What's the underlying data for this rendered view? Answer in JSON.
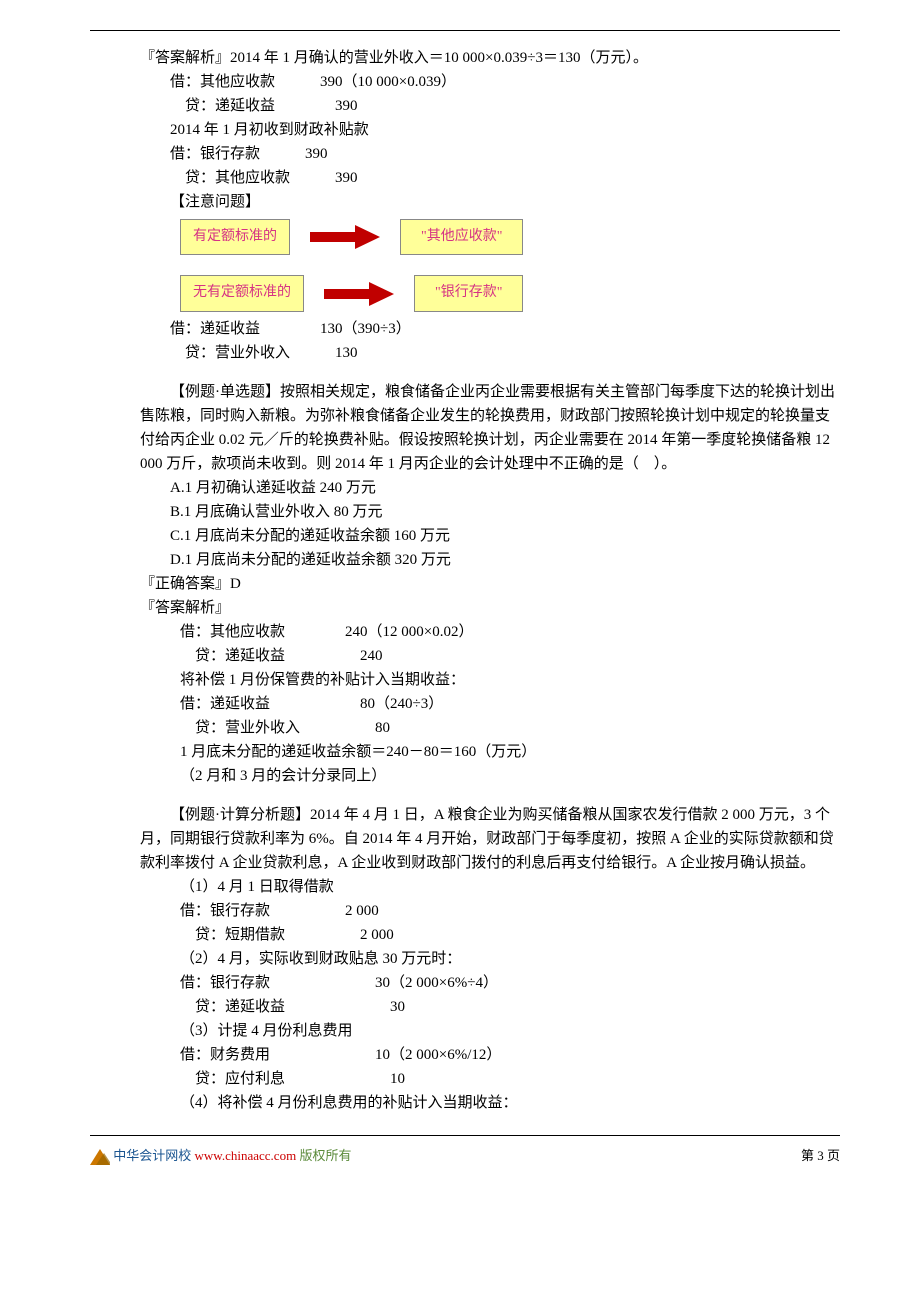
{
  "block1": {
    "l1": "『答案解析』2014 年 1 月确认的营业外收入＝10 000×0.039÷3＝130（万元）。",
    "l2": "借：其他应收款　　　390（10 000×0.039）",
    "l3": "　贷：递延收益　　　　390",
    "l4": "2014 年 1 月初收到财政补贴款",
    "l5": "借：银行存款　　　390",
    "l6": "　贷：其他应收款　　　390",
    "l7": "【注意问题】"
  },
  "boxes": {
    "b1": "有定额标准的",
    "b2": "\"其他应收款\"",
    "b3": "无有定额标准的",
    "b4": "\"银行存款\""
  },
  "block2": {
    "l1": "借：递延收益　　　　130（390÷3）",
    "l2": "　贷：营业外收入　　　130"
  },
  "example1": {
    "intro": "【例题·单选题】按照相关规定，粮食储备企业丙企业需要根据有关主管部门每季度下达的轮换计划出售陈粮，同时购入新粮。为弥补粮食储备企业发生的轮换费用，财政部门按照轮换计划中规定的轮换量支付给丙企业 0.02 元／斤的轮换费补贴。假设按照轮换计划，丙企业需要在 2014 年第一季度轮换储备粮 12 000 万斤，款项尚未收到。则 2014 年 1 月丙企业的会计处理中不正确的是（　）。",
    "a": "A.1 月初确认递延收益 240 万元",
    "b": "B.1 月底确认营业外收入 80 万元",
    "c": "C.1 月底尚未分配的递延收益余额 160 万元",
    "d": "D.1 月底尚未分配的递延收益余额 320 万元",
    "ans": "『正确答案』D",
    "exp": "『答案解析』",
    "e1": "借：其他应收款　　　　240（12 000×0.02）",
    "e2": "　贷：递延收益　　　　　240",
    "e3": "将补偿 1 月份保管费的补贴计入当期收益：",
    "e4": "借：递延收益　　　　　　80（240÷3）",
    "e5": "　贷：营业外收入　　　　　80",
    "e6": "1 月底未分配的递延收益余额＝240－80＝160（万元）",
    "e7": "（2 月和 3 月的会计分录同上）"
  },
  "example2": {
    "intro": "【例题·计算分析题】2014 年 4 月 1 日，A 粮食企业为购买储备粮从国家农发行借款 2 000 万元，3 个月，同期银行贷款利率为 6%。自 2014 年 4 月开始，财政部门于每季度初，按照 A 企业的实际贷款额和贷款利率拨付 A 企业贷款利息，A 企业收到财政部门拨付的利息后再支付给银行。A 企业按月确认损益。",
    "s1": "（1）4 月 1 日取得借款",
    "s1a": "借：银行存款　　　　　2 000",
    "s1b": "　贷：短期借款　　　　　2 000",
    "s2": "（2）4 月，实际收到财政贴息 30 万元时：",
    "s2a": "借：银行存款　　　　　　　30（2 000×6%÷4）",
    "s2b": "　贷：递延收益　　　　　　　30",
    "s3": "（3）计提 4 月份利息费用",
    "s3a": "借：财务费用　　　　　　　10（2 000×6%/12）",
    "s3b": "　贷：应付利息　　　　　　　10",
    "s4": "（4）将补偿 4 月份利息费用的补贴计入当期收益："
  },
  "footer": {
    "brand": "中华会计网校",
    "url": "www.chinaacc.com",
    "rights": "版权所有",
    "page": "第 3 页"
  }
}
